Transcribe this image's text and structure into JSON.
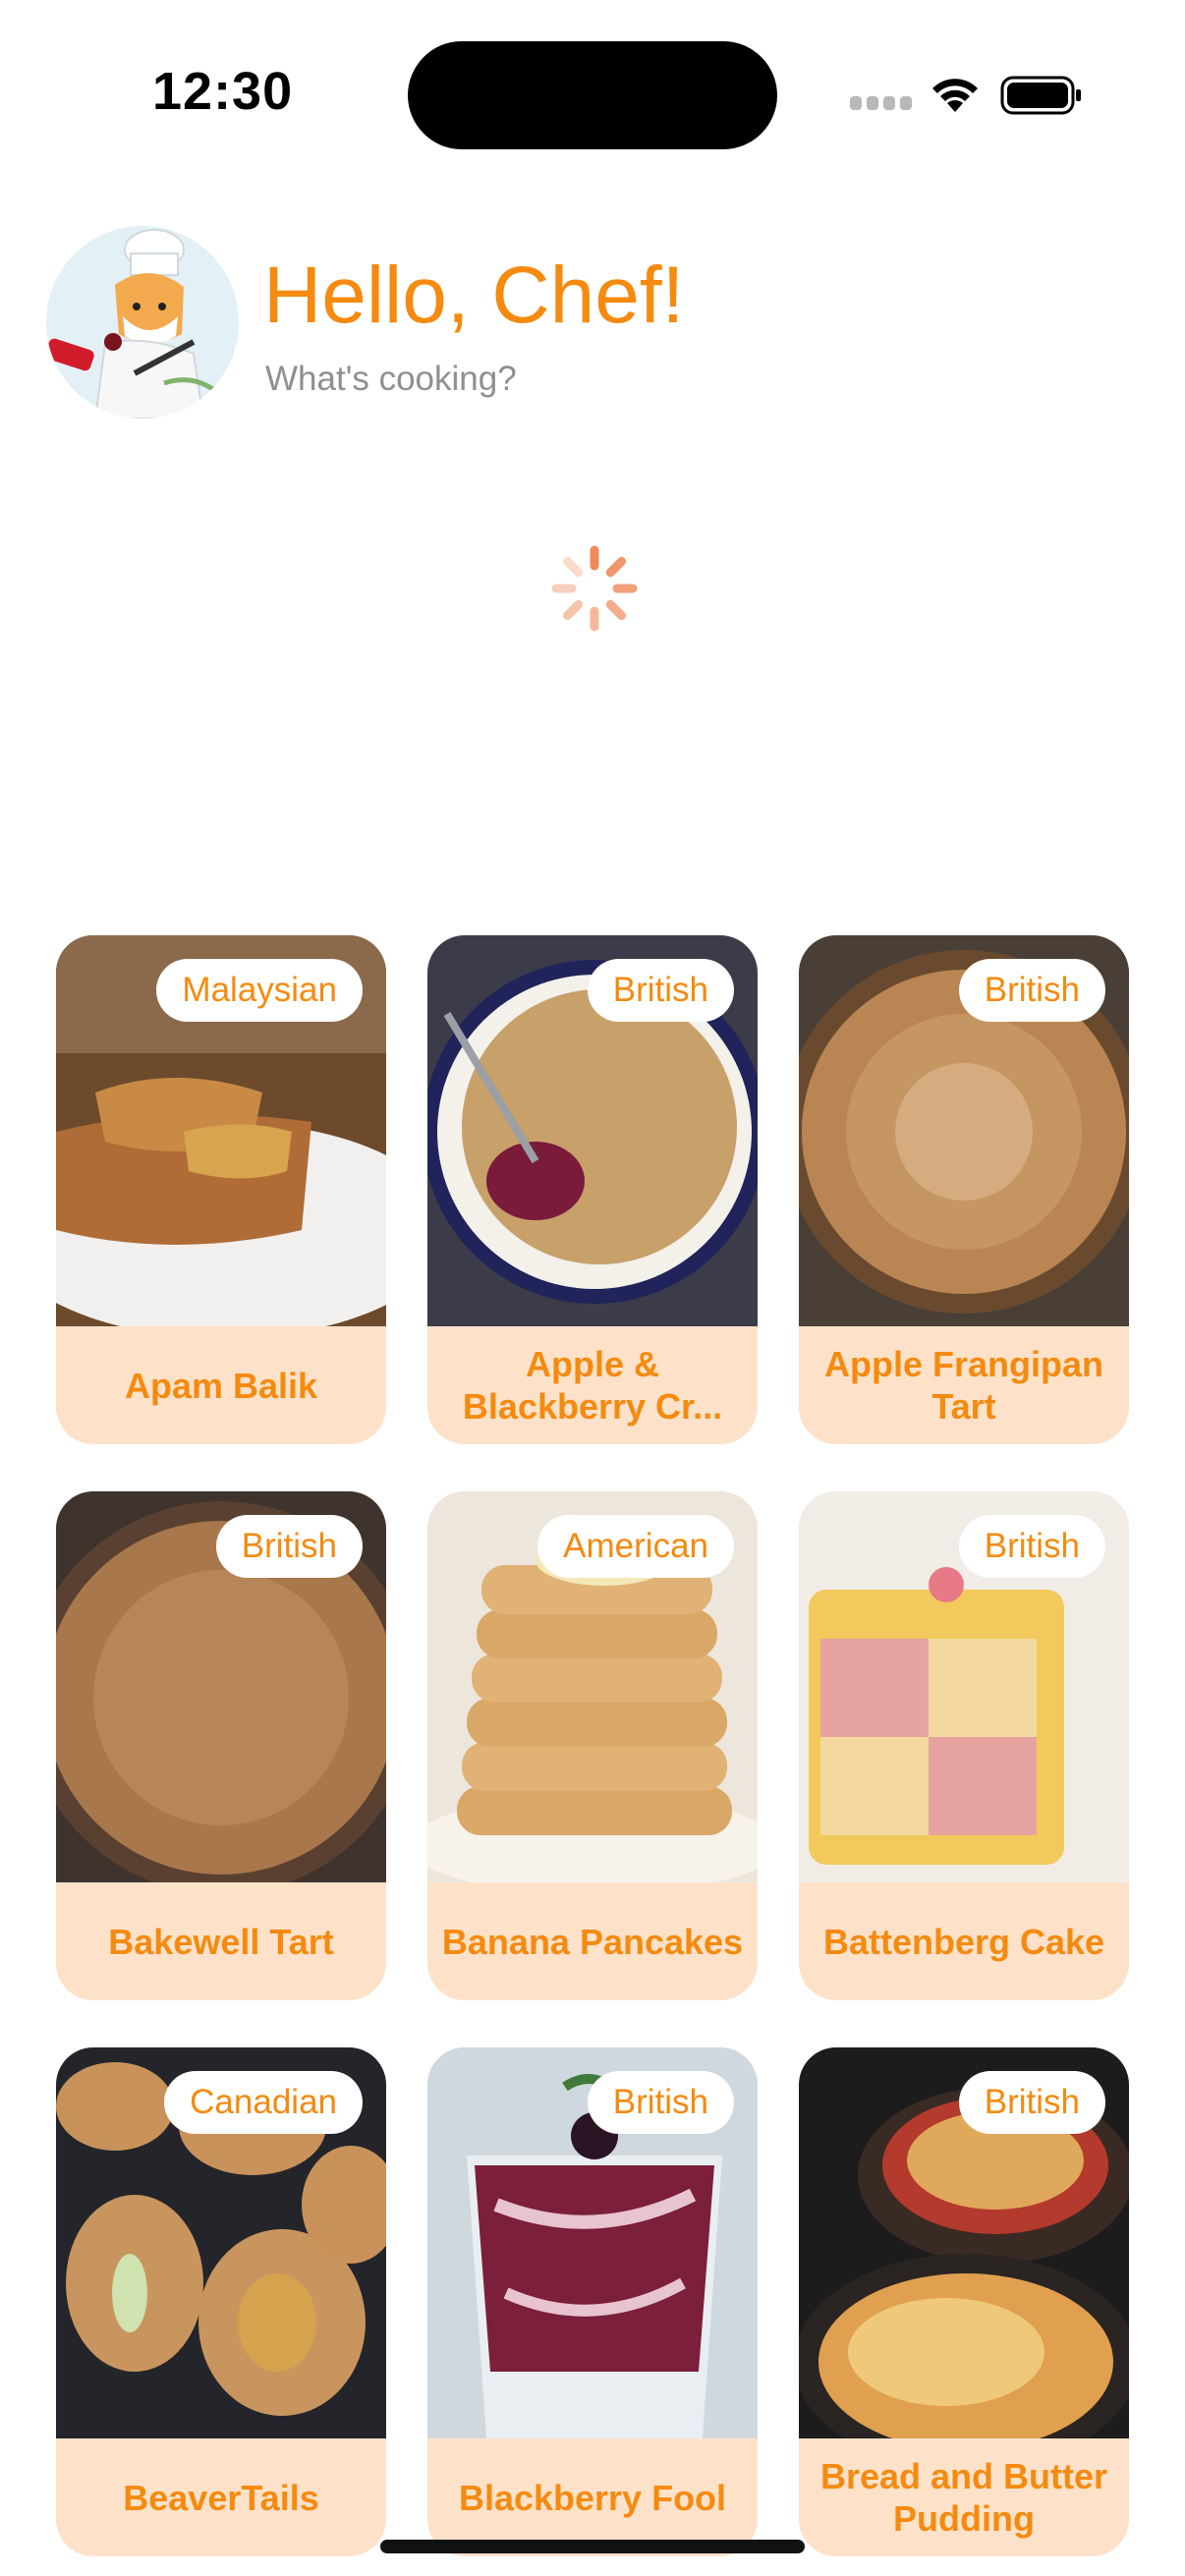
{
  "status_bar": {
    "time": "12:30"
  },
  "header": {
    "greeting": "Hello, Chef!",
    "subtitle": "What's cooking?",
    "avatar_icon": "chef-avatar"
  },
  "loading": {
    "icon": "spinner-icon",
    "color": "#f58a10"
  },
  "colors": {
    "accent": "#f58a10",
    "card_bg": "#fde2c9",
    "badge_bg": "#ffffff"
  },
  "recipes": [
    {
      "name": "Apam Balik",
      "cuisine": "Malaysian"
    },
    {
      "name": "Apple & Blackberry Cr...",
      "cuisine": "British"
    },
    {
      "name": "Apple Frangipan Tart",
      "cuisine": "British"
    },
    {
      "name": "Bakewell Tart",
      "cuisine": "British"
    },
    {
      "name": "Banana Pancakes",
      "cuisine": "American"
    },
    {
      "name": "Battenberg Cake",
      "cuisine": "British"
    },
    {
      "name": "BeaverTails",
      "cuisine": "Canadian"
    },
    {
      "name": "Blackberry Fool",
      "cuisine": "British"
    },
    {
      "name": "Bread and Butter Pudding",
      "cuisine": "British"
    }
  ]
}
